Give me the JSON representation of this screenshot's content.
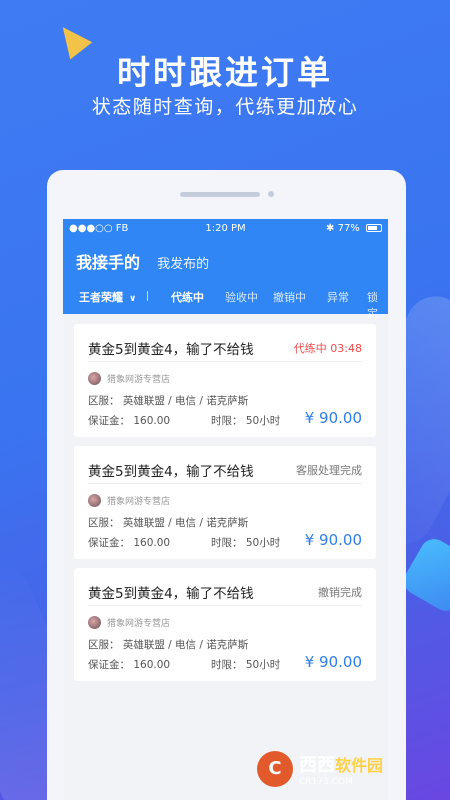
{
  "headline": "时时跟进订单",
  "subline": "状态随时查询，代练更加放心",
  "statusbar": {
    "left": "●●●○○ FB",
    "time": "1:20 PM",
    "battery": "77%"
  },
  "header": {
    "tab_active": "我接手的",
    "tab_other": "我发布的"
  },
  "filters": {
    "game": "王者荣耀",
    "items": [
      "代练中",
      "验收中",
      "撤销中",
      "异常",
      "锁定"
    ],
    "active": "代练中"
  },
  "orders": [
    {
      "title": "黄金5到黄金4，输了不给钱",
      "status": "代练中 03:48",
      "shop": "猎象网游专营店",
      "region": "区服：  英雄联盟 / 电信 / 诺克萨斯",
      "deposit": "保证金：  160.00",
      "limit": "时限：  50小时",
      "price": "¥ 90.00"
    },
    {
      "title": "黄金5到黄金4，输了不给钱",
      "status": "客服处理完成",
      "shop": "猎象网游专营店",
      "region": "区服：  英雄联盟 / 电信 / 诺克萨斯",
      "deposit": "保证金：  160.00",
      "limit": "时限：  50小时",
      "price": "¥ 90.00"
    },
    {
      "title": "黄金5到黄金4，输了不给钱",
      "status": "撤销完成",
      "shop": "猎象网游专营店",
      "region": "区服：  英雄联盟 / 电信 / 诺克萨斯",
      "deposit": "保证金：  160.00",
      "limit": "时限：  50小时",
      "price": "¥ 90.00"
    }
  ],
  "watermark": {
    "logo": "C",
    "brand": "西西",
    "sub": "软件园",
    "url": "CR173.COM"
  },
  "colors": {
    "primary": "#2f86f4",
    "price": "#2f7ee8",
    "status_red": "#ef4b4b"
  }
}
